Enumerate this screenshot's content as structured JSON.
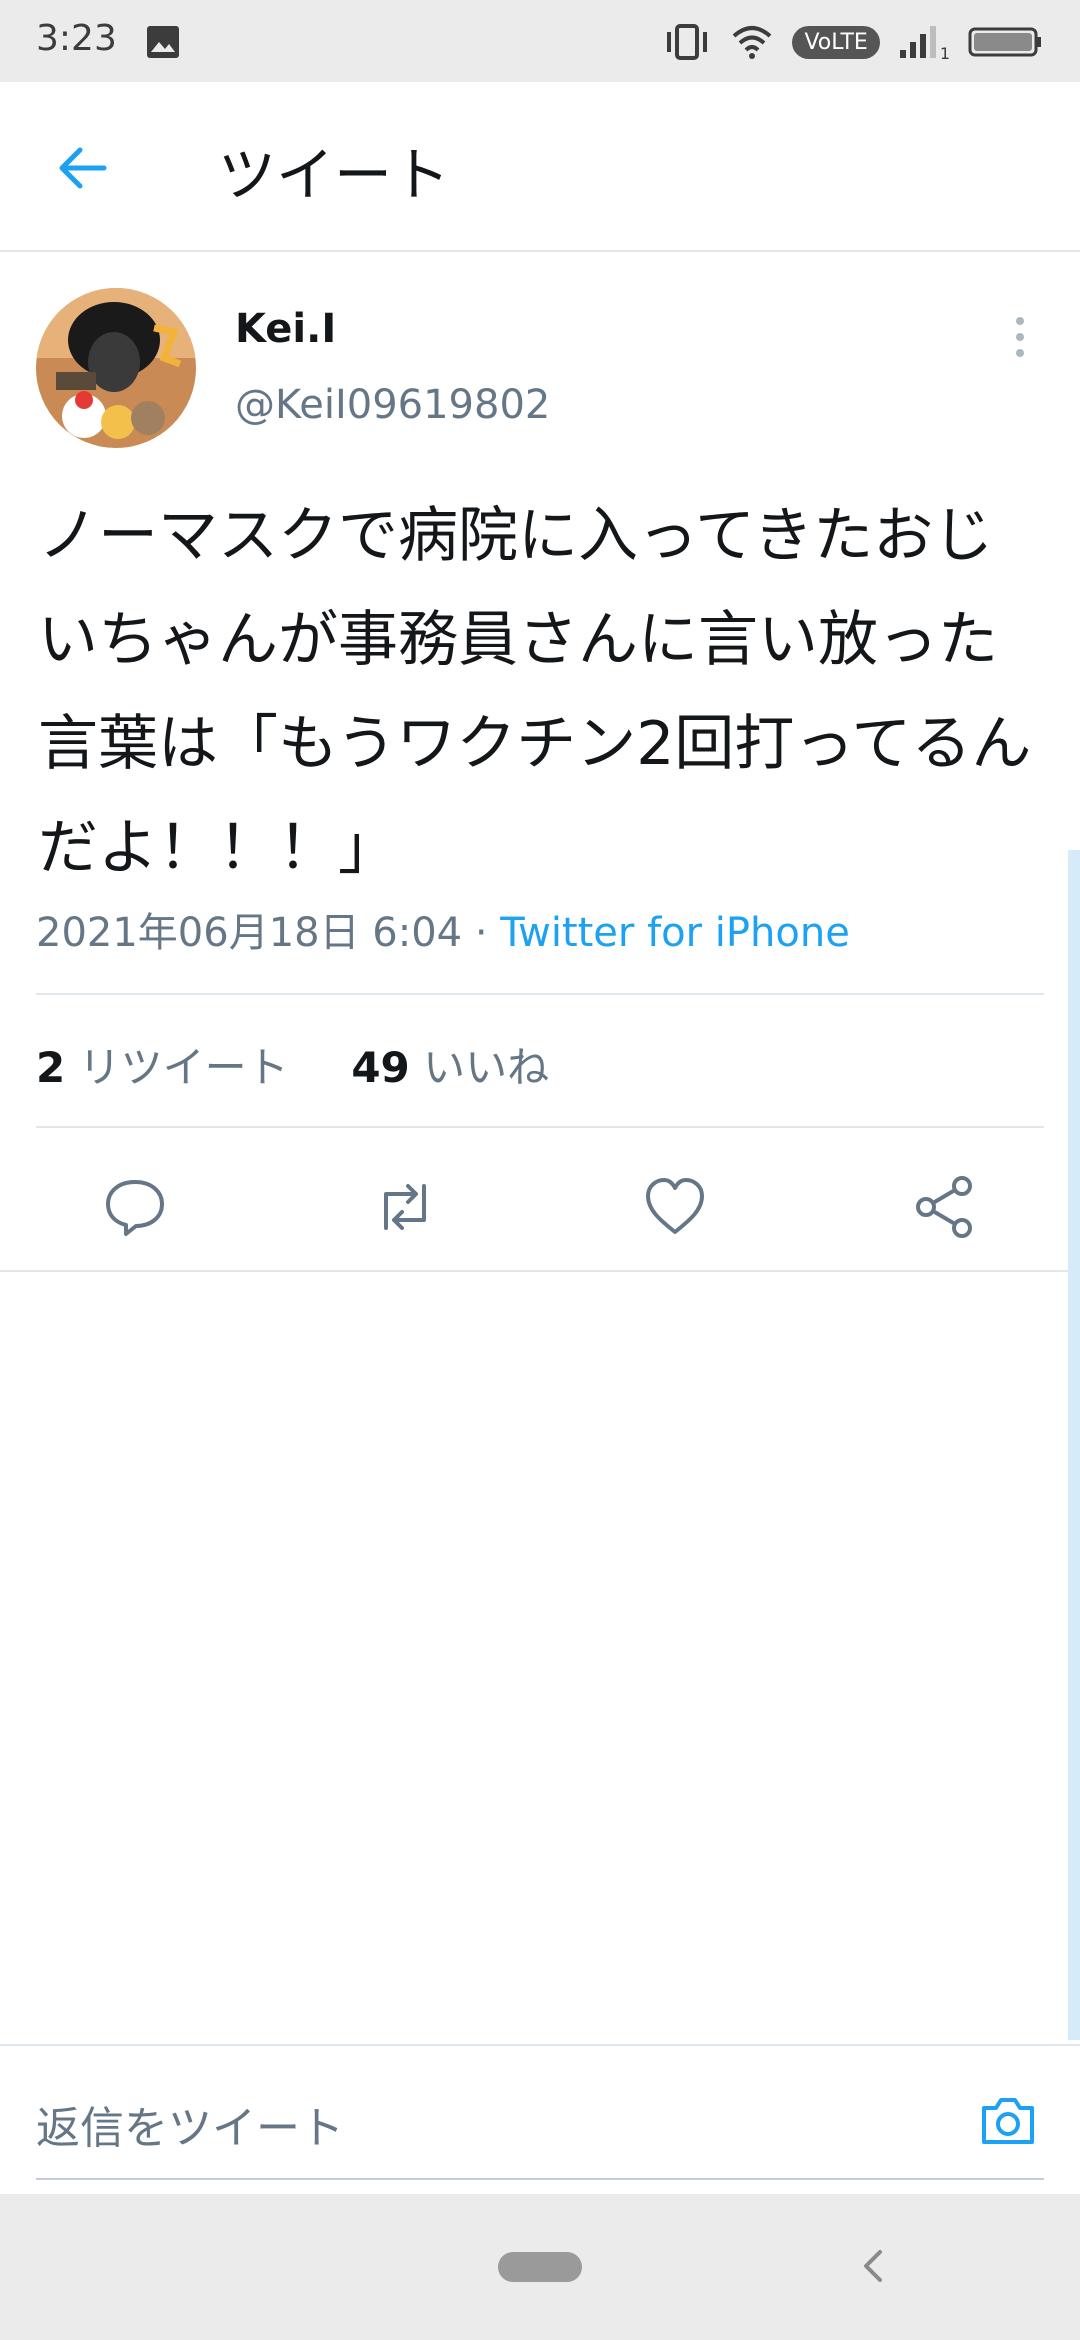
{
  "status_bar": {
    "time": "3:23",
    "network_label": "VoLTE",
    "sim_slot": "1"
  },
  "header": {
    "title": "ツイート"
  },
  "tweet": {
    "author_name": "Kei.I",
    "author_handle": "@KeiI09619802",
    "text": "ノーマスクで病院に入ってきたおじいちゃんが事務員さんに言い放った言葉は「もうワクチン2回打ってるんだよ！！！」",
    "timestamp": "2021年06月18日 6:04",
    "separator": " · ",
    "source": "Twitter for iPhone"
  },
  "stats": {
    "retweet_count": "2",
    "retweet_label": "リツイート",
    "like_count": "49",
    "like_label": "いいね"
  },
  "reply_bar": {
    "placeholder": "返信をツイート"
  },
  "colors": {
    "accent": "#1da1f2",
    "secondary_text": "#657786",
    "divider": "#e1e8ed"
  },
  "icons": [
    "back-arrow-icon",
    "more-vert-icon",
    "reply-icon",
    "retweet-icon",
    "like-icon",
    "share-icon",
    "camera-icon",
    "image-icon"
  ]
}
